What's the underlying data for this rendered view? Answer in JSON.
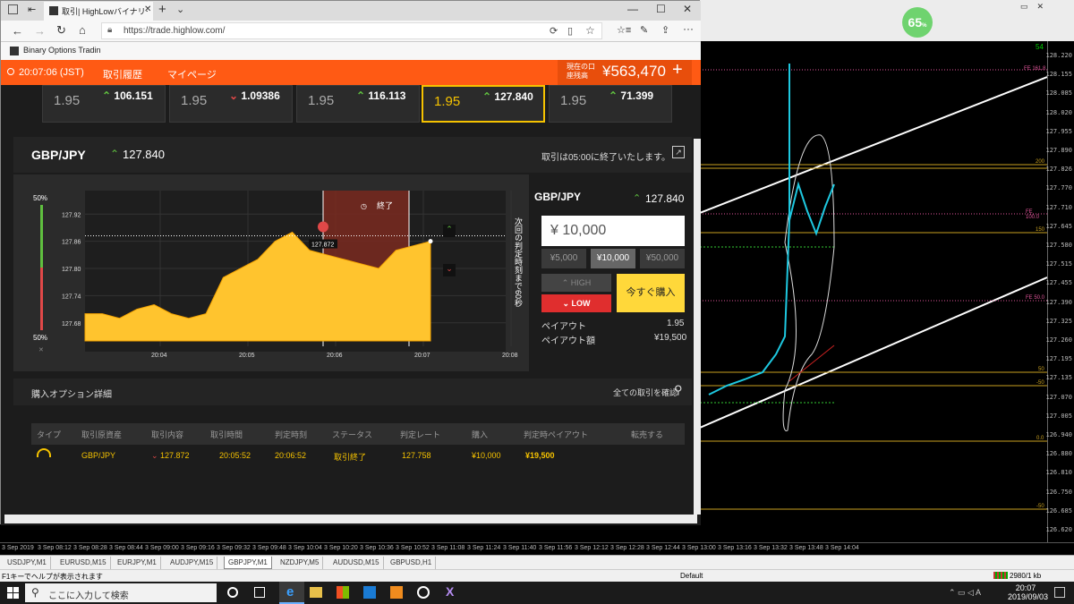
{
  "browser": {
    "tab_title": "取引| HighLowバイナリーオ",
    "url": "https://trade.highlow.com/",
    "favorite": "Binary Options Tradin"
  },
  "highlow_nav": {
    "time": "20:07:06 (JST)",
    "history": "取引履歴",
    "mypage": "マイページ",
    "balance_label": "現在の口座残高",
    "balance": "¥563,470",
    "plus": "+"
  },
  "cards": [
    {
      "payout": "1.95",
      "price": "106.151",
      "dir": "up"
    },
    {
      "payout": "1.95",
      "price": "1.09386",
      "dir": "down"
    },
    {
      "payout": "1.95",
      "price": "116.113",
      "dir": "up"
    },
    {
      "payout": "1.95",
      "price": "127.840",
      "dir": "up",
      "selected": true
    },
    {
      "payout": "1.95",
      "price": "71.399",
      "dir": "up"
    }
  ],
  "asset": {
    "pair": "GBP/JPY",
    "price": "127.840",
    "closing_notice": "取引は05:00に終了いたします。"
  },
  "chart": {
    "pct_top": "50%",
    "pct_bottom": "50%",
    "expired_label": "終了",
    "strike_label": "127.872",
    "next_judgement": "次回の判定時刻まで60秒",
    "y_labels": [
      "127.92",
      "127.86",
      "127.80",
      "127.74",
      "127.68"
    ],
    "x_labels": [
      "20:04",
      "20:05",
      "20:06",
      "20:07",
      "20:08"
    ]
  },
  "chart_data": {
    "type": "area",
    "x": [
      "20:04",
      "20:05",
      "20:06",
      "20:07"
    ],
    "ylim": [
      127.64,
      127.96
    ],
    "strike": 127.872,
    "series": [
      {
        "values": [
          127.7,
          127.7,
          127.69,
          127.71,
          127.72,
          127.7,
          127.69,
          127.7,
          127.78,
          127.8,
          127.82,
          127.86,
          127.88,
          127.84,
          127.83,
          127.82,
          127.81,
          127.8,
          127.84,
          127.85,
          127.86
        ]
      }
    ]
  },
  "order": {
    "pair": "GBP/JPY",
    "price": "127.840",
    "amount": "¥ 10,000",
    "preset1": "¥5,000",
    "preset2": "¥10,000",
    "preset3": "¥50,000",
    "high": "HIGH",
    "low": "LOW",
    "buy_now": "今すぐ購入",
    "payout_label": "ペイアウト",
    "payout_value": "1.95",
    "payout_amount_label": "ペイアウト額",
    "payout_amount_value": "¥19,500"
  },
  "details": {
    "title": "購入オプション詳細",
    "see_all": "全ての取引を確認",
    "headers": [
      "タイプ",
      "取引原資産",
      "取引内容",
      "取引時間",
      "判定時刻",
      "ステータス",
      "判定レート",
      "購入",
      "判定時ペイアウト",
      "転売する"
    ],
    "row": [
      "",
      "GBP/JPY",
      "127.872",
      "20:05:52",
      "20:06:52",
      "取引終了",
      "127.758",
      "¥10,000",
      "¥19,500",
      ""
    ]
  },
  "mt4": {
    "indicator_pct": "65",
    "y_labels": [
      "128.220",
      "128.155",
      "128.085",
      "128.020",
      "127.955",
      "127.890",
      "127.826",
      "127.770",
      "127.710",
      "127.645",
      "127.580",
      "127.515",
      "127.455",
      "127.390",
      "127.325",
      "127.260",
      "127.195",
      "127.135",
      "127.070",
      "127.005",
      "126.940",
      "126.880",
      "126.810",
      "126.750",
      "126.685",
      "126.620"
    ],
    "fe_labels": [
      "FE 161.8",
      "200",
      "FE 100.0",
      "150",
      "FE 50.0",
      "50",
      "-50",
      "0.0",
      "-50"
    ],
    "time_labels": [
      "3 Sep 2019",
      "3 Sep 08:12",
      "3 Sep 08:28",
      "3 Sep 08:44",
      "3 Sep 09:00",
      "3 Sep 09:16",
      "3 Sep 09:32",
      "3 Sep 09:48",
      "3 Sep 10:04",
      "3 Sep 10:20",
      "3 Sep 10:36",
      "3 Sep 10:52",
      "3 Sep 11:08",
      "3 Sep 11:24",
      "3 Sep 11:40",
      "3 Sep 11:56",
      "3 Sep 12:12",
      "3 Sep 12:28",
      "3 Sep 12:44",
      "3 Sep 13:00",
      "3 Sep 13:16",
      "3 Sep 13:32",
      "3 Sep 13:48",
      "3 Sep 14:04"
    ],
    "tabs": [
      "USDJPY,M1",
      "EURUSD,M15",
      "EURJPY,M1",
      "AUDJPY,M15",
      "GBPJPY,M1",
      "NZDJPY,M5",
      "AUDUSD,M15",
      "GBPUSD,H1"
    ],
    "status_help": "F1キーでヘルプが表示されます",
    "status_profile": "Default",
    "status_traffic": "2980/1 kb",
    "counter": "54"
  },
  "taskbar": {
    "search_placeholder": "ここに入力して検索",
    "time": "20:07",
    "date": "2019/09/03"
  }
}
